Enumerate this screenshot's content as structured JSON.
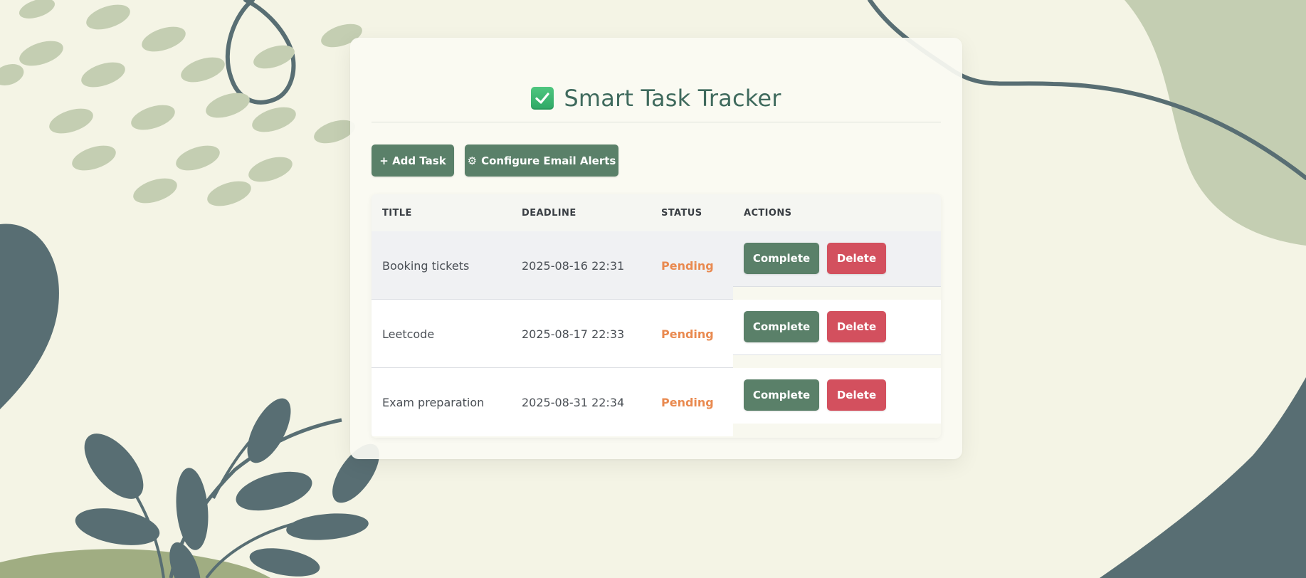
{
  "app": {
    "title": "Smart Task Tracker",
    "title_icon": "check-box-icon"
  },
  "toolbar": {
    "add_label": "+ Add Task",
    "email_icon": "gear-icon",
    "email_gear": "⚙",
    "email_label": "Configure Email Alerts"
  },
  "table": {
    "headers": {
      "title": "TITLE",
      "deadline": "DEADLINE",
      "status": "STATUS",
      "actions": "ACTIONS"
    },
    "rows": [
      {
        "title": "Booking tickets",
        "deadline": "2025-08-16 22:31",
        "status": "Pending",
        "complete_label": "Complete",
        "delete_label": "Delete"
      },
      {
        "title": "Leetcode",
        "deadline": "2025-08-17 22:33",
        "status": "Pending",
        "complete_label": "Complete",
        "delete_label": "Delete"
      },
      {
        "title": "Exam preparation",
        "deadline": "2025-08-31 22:34",
        "status": "Pending",
        "complete_label": "Complete",
        "delete_label": "Delete"
      }
    ]
  },
  "colors": {
    "background": "#f4f4e5",
    "accent_green": "#5a8069",
    "danger_red": "#d3505e",
    "pending_orange": "#e98a50",
    "title_green": "#3f6a5d"
  }
}
